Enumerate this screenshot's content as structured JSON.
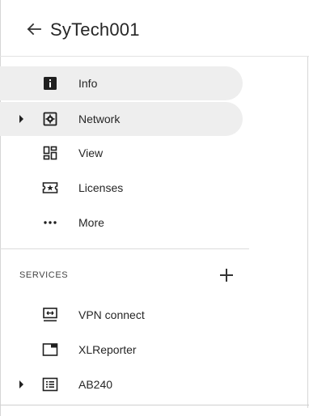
{
  "header": {
    "back_icon": "arrow-left-icon",
    "title": "SyTech001"
  },
  "nav": {
    "items": [
      {
        "label": "Info",
        "icon": "info-icon",
        "active": true
      },
      {
        "label": "Network",
        "icon": "network-settings-icon",
        "active": true,
        "expandable": true
      },
      {
        "label": "View",
        "icon": "dashboard-view-icon"
      },
      {
        "label": "Licenses",
        "icon": "license-ticket-icon"
      },
      {
        "label": "More",
        "icon": "more-dots-icon"
      }
    ]
  },
  "services": {
    "section_label": "SERVICES",
    "add_icon": "plus-icon",
    "items": [
      {
        "label": "VPN connect",
        "icon": "vpn-monitor-icon"
      },
      {
        "label": "XLReporter",
        "icon": "window-icon"
      },
      {
        "label": "AB240",
        "icon": "list-icon",
        "expandable": true
      }
    ]
  },
  "colors": {
    "active_bg": "#eeeeee",
    "text": "#262626",
    "divider": "#dcdcdc"
  }
}
